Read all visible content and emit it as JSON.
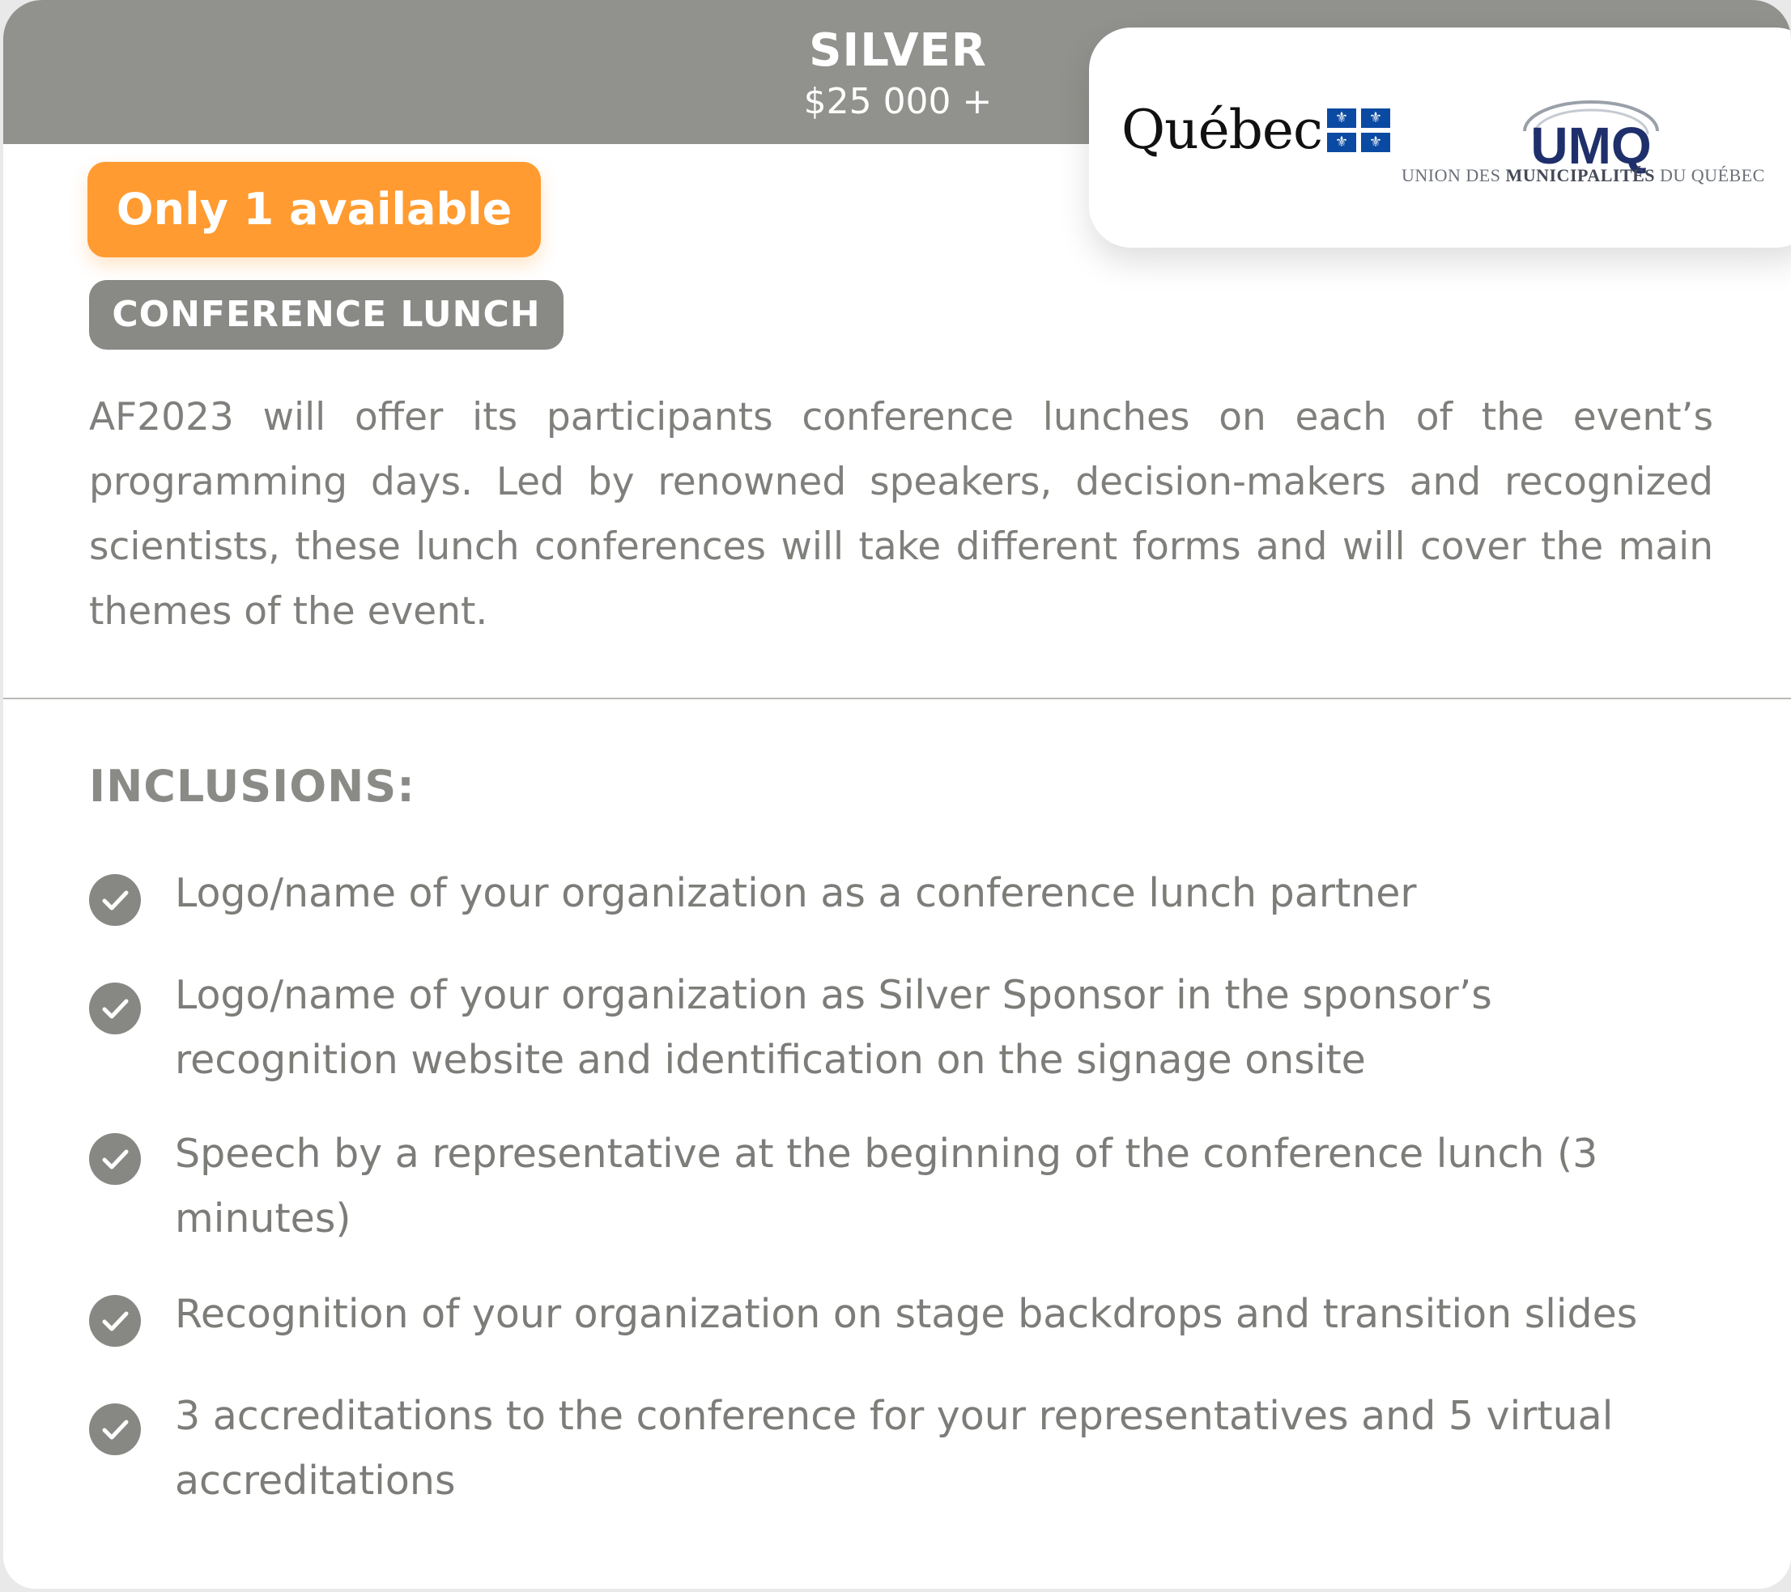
{
  "header": {
    "tier": "SILVER",
    "price": "$25 000 +"
  },
  "partners": {
    "quebec_logo_text": "Québec",
    "umq_logo_text": "UMQ",
    "umq_tagline_pre": "UNION DES ",
    "umq_tagline_bold": "MUNICIPALITÉS",
    "umq_tagline_post": " DU QUÉBEC",
    "colors": {
      "quebec_blue": "#0b4aa2",
      "umq_navy": "#1f2f6b"
    }
  },
  "badge": {
    "label": "Only 1 available",
    "color": "#ff9b31"
  },
  "category": {
    "label": "CONFERENCE LUNCH"
  },
  "description": "AF2023 will offer its participants conference lunches on each of the event’s programming days. Led by renowned speakers, decision-makers and recognized scientists, these lunch conferences will take different forms and will cover the main themes of the event.",
  "inclusions": {
    "title": "INCLUSIONS:",
    "items": [
      "Logo/name of your organization as a conference lunch partner",
      "Logo/name of your organization as Silver Sponsor in the sponsor’s recognition website and identification on the signage onsite",
      "Speech by a representative at the beginning of the conference lunch (3 minutes)",
      "Recognition of your organization on stage backdrops and transition slides",
      "3 accreditations to the conference for your representatives and 5 virtual accreditations"
    ],
    "icon": "check-circle-icon"
  }
}
